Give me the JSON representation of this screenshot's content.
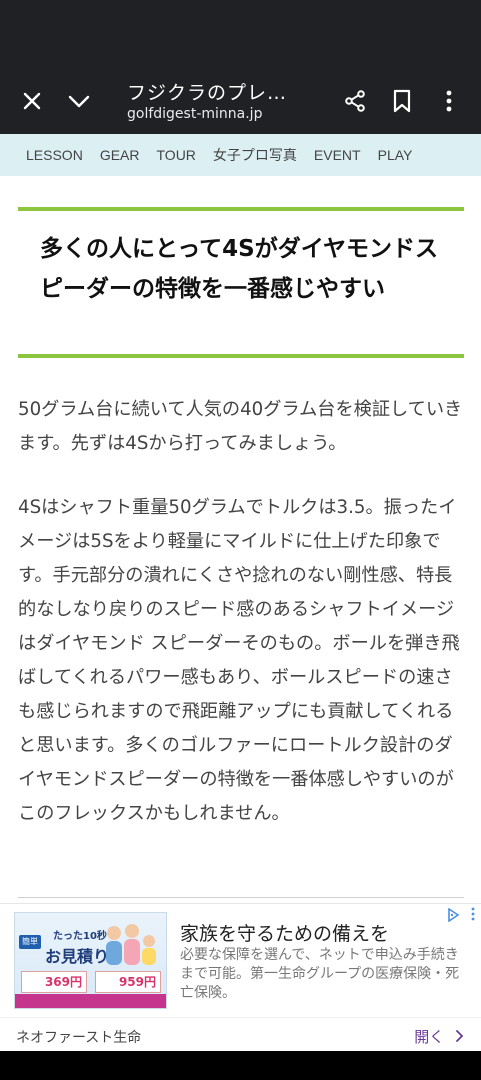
{
  "browser": {
    "title": "フジクラのプレ…",
    "url": "golfdigest-minna.jp"
  },
  "nav": {
    "items": [
      "LESSON",
      "GEAR",
      "TOUR",
      "女子プロ写真",
      "EVENT",
      "PLAY"
    ]
  },
  "article": {
    "headline": "多くの人にとって4Sがダイヤモンドスピーダーの特徴を一番感じやすい",
    "paragraph1": "50グラム台に続いて人気の40グラム台を検証していきます。先ずは4Sから打ってみましょう。",
    "paragraph2": "4Sはシャフト重量50グラムでトルクは3.5。振ったイメージは5Sをより軽量にマイルドに仕上げた印象です。手元部分の潰れにくさや捻れのない剛性感、特長的なしなり戻りのスピード感のあるシャフトイメージはダイヤモンド スピーダーそのもの。ボールを弾き飛ばしてくれるパワー感もあり、ボールスピードの速さも感じられますので飛距離アップにも貢献してくれると思います。多くのゴルファーにロートルク設計のダイヤモンドスピーダーの特徴を一番体感しやすいのがこのフレックスかもしれません。"
  },
  "ad": {
    "image_badge": "簡単",
    "image_heading": "たった10秒で",
    "image_main": "お見積り",
    "price1": "369円",
    "price2": "959円",
    "title": "家族を守るための備えを",
    "body": "必要な保障を選んで、ネットで申込み手続きまで可能。第一生命グループの医療保険・死亡保険。",
    "sponsor": "ネオファースト生命",
    "cta": "開く",
    "colors": {
      "accent": "#c5358e",
      "cta": "#6a3a99",
      "choices": "#4a90e2"
    }
  },
  "colors": {
    "toolbar": "#202124",
    "nav_bg": "#dcf0f4",
    "headline_rule": "#8cc63f"
  },
  "icons": [
    "close-icon",
    "chevron-down-icon",
    "share-icon",
    "bookmark-icon",
    "more-vert-icon",
    "ad-choices-icon",
    "chevron-right-icon"
  ]
}
